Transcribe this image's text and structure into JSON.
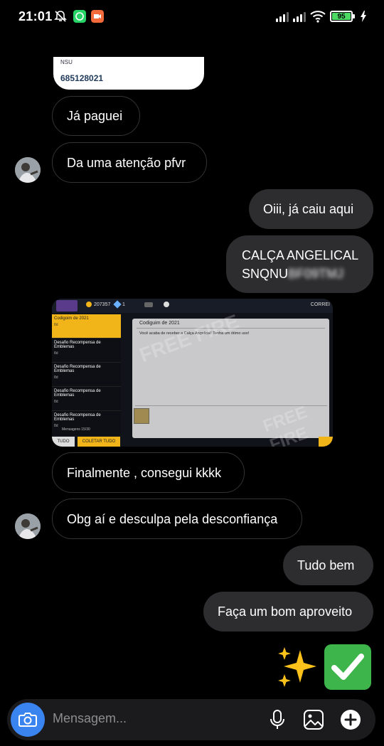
{
  "status_bar": {
    "time": "21:01",
    "battery": "95",
    "icons": [
      "mute-bell-icon",
      "whatsapp-icon",
      "video-app-icon",
      "signal-icon",
      "signal-icon",
      "wifi-icon",
      "battery-icon",
      "charging-icon"
    ]
  },
  "chat": {
    "nsu_card": {
      "label": "NSU",
      "number": "685128021"
    },
    "messages": [
      {
        "side": "in",
        "text": "Já paguei"
      },
      {
        "side": "in",
        "text": "Da uma atenção pfvr"
      },
      {
        "side": "out",
        "text": "Oiii, já caiu aqui"
      },
      {
        "side": "out",
        "line1": "CALÇA ANGELICAL",
        "line2_visible": "SNQNU",
        "line2_hidden": "BF09TMJ"
      },
      {
        "side": "in",
        "text": "Finalmente , consegui kkkk"
      },
      {
        "side": "in",
        "text": "Obg aí e desculpa pela desconfiança"
      },
      {
        "side": "out",
        "text": "Tudo bem"
      },
      {
        "side": "out",
        "text": "Faça um bom aproveito"
      }
    ],
    "shared_image": {
      "coins": "207357",
      "diamonds": "1",
      "top_right": "CORREI",
      "sidebar": [
        {
          "title": "Codigoim de 2021",
          "sub": "8d"
        },
        {
          "title": "Desafio Recompensa de Emblemas",
          "sub": "8d"
        },
        {
          "title": "Desafio Recompensa de Emblemas",
          "sub": "8d"
        },
        {
          "title": "Desafio Recompensa de Emblemas",
          "sub": "8d"
        },
        {
          "title": "Desafio Recompensa de Emblemas",
          "sub": "8d"
        }
      ],
      "messages_count": "Mensagens 15/30",
      "panel_title": "Codiguim de 2021",
      "panel_text": "Você acaba de receber a Calça Angelical! Tenha um ótimo uso!",
      "btn_all": "TUDO",
      "btn_collect": "COLETAR TUDO",
      "watermark": "FREE FIRE"
    },
    "reaction_emojis": [
      "sparkles-emoji",
      "check-mark-button-emoji"
    ]
  },
  "composer": {
    "placeholder": "Mensagem...",
    "icons": [
      "camera-icon",
      "microphone-icon",
      "gallery-icon",
      "add-icon"
    ],
    "colors": {
      "camera_bg": "#3a84f0"
    }
  },
  "colors": {
    "background": "#000000",
    "outgoing_bubble": "#2d2d2f",
    "incoming_border": "#333333"
  }
}
